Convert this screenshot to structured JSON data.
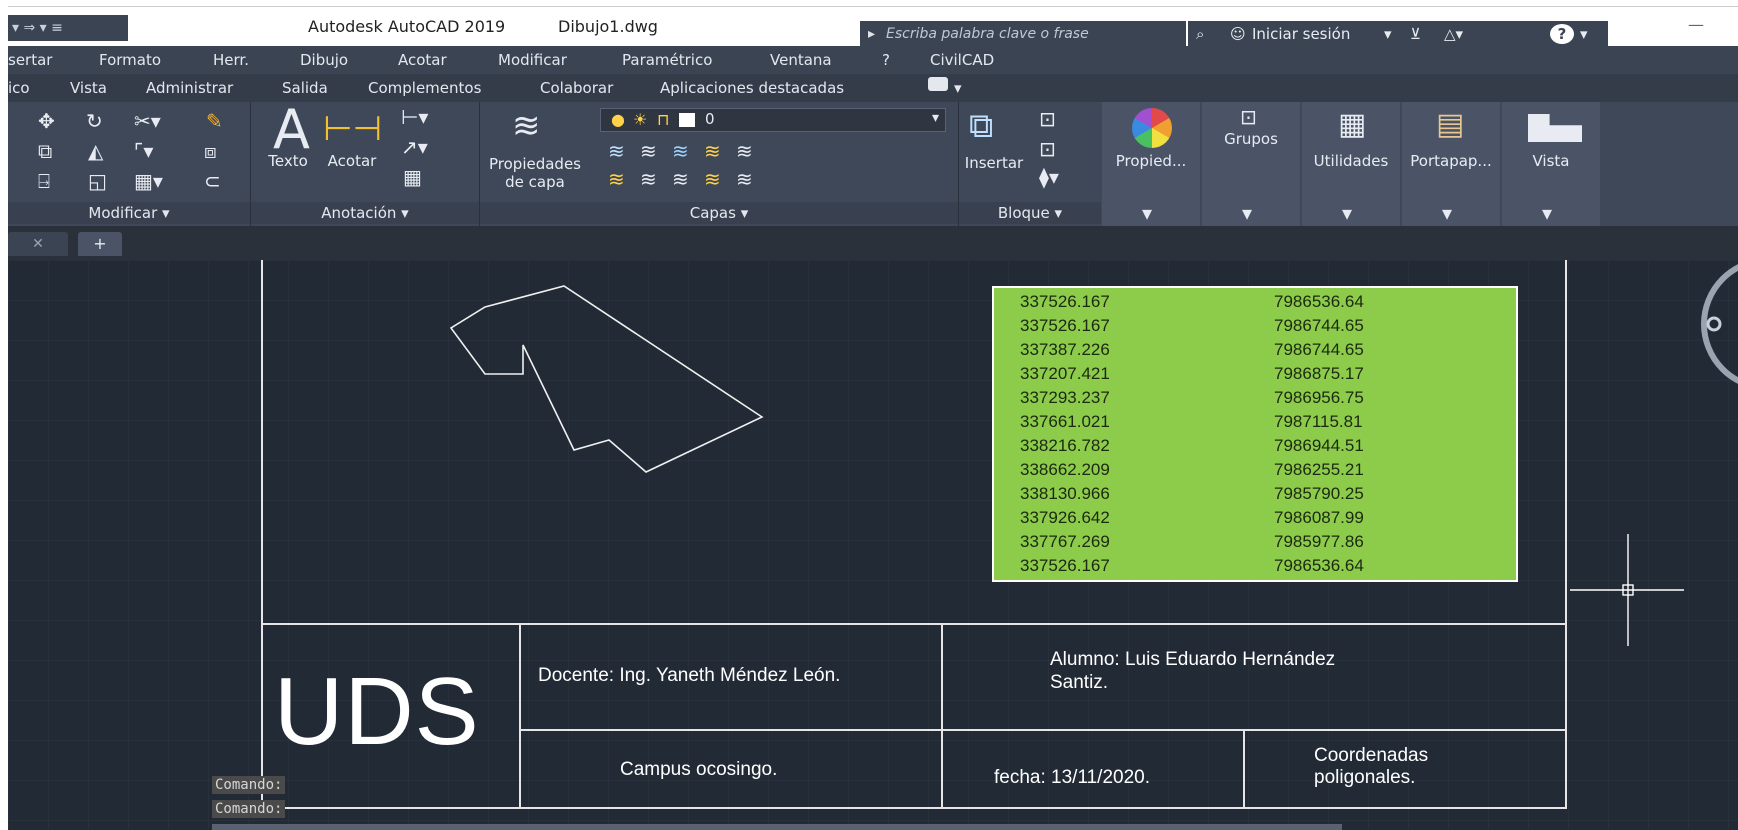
{
  "titlebar": {
    "quick_access": "▾ ⇒ ▾ ≡",
    "app_title": "Autodesk AutoCAD 2019",
    "file_name": "Dibujo1.dwg",
    "search_placeholder": "Escriba palabra clave o frase",
    "sign_in": "Iniciar sesión",
    "minimize": "—"
  },
  "menubar": {
    "items": [
      "sertar",
      "Formato",
      "Herr.",
      "Dibujo",
      "Acotar",
      "Modificar",
      "Paramétrico",
      "Ventana",
      "?",
      "CivilCAD"
    ]
  },
  "ribbon_tabs": {
    "items": [
      "ico",
      "Vista",
      "Administrar",
      "Salida",
      "Complementos",
      "Colaborar",
      "Aplicaciones destacadas"
    ]
  },
  "ribbon": {
    "modificar": {
      "title": "Modificar ▾"
    },
    "anotacion": {
      "title": "Anotación ▾",
      "texto": "Texto",
      "acotar": "Acotar"
    },
    "capas": {
      "title": "Capas ▾",
      "prop_line1": "Propiedades",
      "prop_line2": "de capa",
      "layer_name": "0"
    },
    "bloque": {
      "title": "Bloque ▾",
      "insertar": "Insertar"
    },
    "propied": {
      "label": "Propied..."
    },
    "grupos": {
      "label": "Grupos"
    },
    "utilidades": {
      "label": "Utilidades"
    },
    "portapap": {
      "label": "Portapap..."
    },
    "vista": {
      "label": "Vista"
    }
  },
  "doc_tabs": {
    "close": "✕",
    "add": "+"
  },
  "coordinates": {
    "rows": [
      {
        "x": "337526.167",
        "y": "7986536.64"
      },
      {
        "x": "337526.167",
        "y": "7986744.65"
      },
      {
        "x": "337387.226",
        "y": "7986744.65"
      },
      {
        "x": "337207.421",
        "y": "7986875.17"
      },
      {
        "x": "337293.237",
        "y": "7986956.75"
      },
      {
        "x": "337661.021",
        "y": "7987115.81"
      },
      {
        "x": "338216.782",
        "y": "7986944.51"
      },
      {
        "x": "338662.209",
        "y": "7986255.21"
      },
      {
        "x": "338130.966",
        "y": "7985790.25"
      },
      {
        "x": "337926.642",
        "y": "7986087.99"
      },
      {
        "x": "337767.269",
        "y": "7985977.86"
      },
      {
        "x": "337526.167",
        "y": "7986536.64"
      }
    ]
  },
  "titleblock": {
    "logo": "UDS",
    "docente": "Docente: Ing. Yaneth Méndez León.",
    "alumno_line1": "Alumno: Luis Eduardo Hernández",
    "alumno_line2": "Santiz.",
    "campus": "Campus ocosingo.",
    "fecha": "fecha: 13/11/2020.",
    "tema_line1": "Coordenadas",
    "tema_line2": "poligonales."
  },
  "command_line": {
    "lines": [
      "Comando:",
      "Comando:"
    ]
  },
  "colors": {
    "ribbon_bg": "#3f4858",
    "canvas_bg": "#222a35",
    "table_fill": "#8dcb4b",
    "linework": "#ffffff"
  }
}
